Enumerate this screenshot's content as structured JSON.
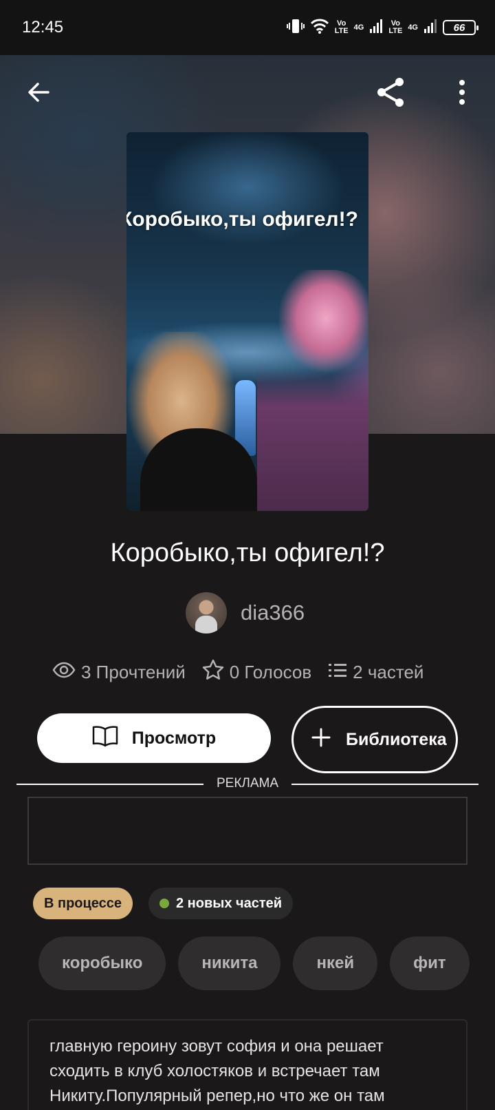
{
  "status_bar": {
    "time": "12:45",
    "volte1": "Vo\nLTE",
    "net1": "4G",
    "volte2": "Vo\nLTE",
    "net2": "4G",
    "battery": "66"
  },
  "header": {
    "back_icon": "arrow-left-icon",
    "share_icon": "share-icon",
    "more_icon": "more-vertical-icon"
  },
  "cover": {
    "text": "Коробыко,ты офигел!?"
  },
  "story": {
    "title": "Коробыко,ты офигел!?",
    "author": "dia366"
  },
  "stats": {
    "reads": "3 Прочтений",
    "votes": "0 Голосов",
    "parts": "2 частей"
  },
  "actions": {
    "read_label": "Просмотр",
    "library_label": "Библиотека"
  },
  "ad": {
    "label": "РЕКЛАМА"
  },
  "badges": {
    "status": "В процессе",
    "new_parts": "2 новых частей",
    "new_dot_color": "#7aa83c",
    "status_color": "#d8b37c"
  },
  "tags": [
    "коробыко",
    "никита",
    "нкей",
    "фит"
  ],
  "description": "главную героину зовут софия и она решает сходить в клуб холостяков и встречает там Никиту.Популярный репер,но что же он там"
}
